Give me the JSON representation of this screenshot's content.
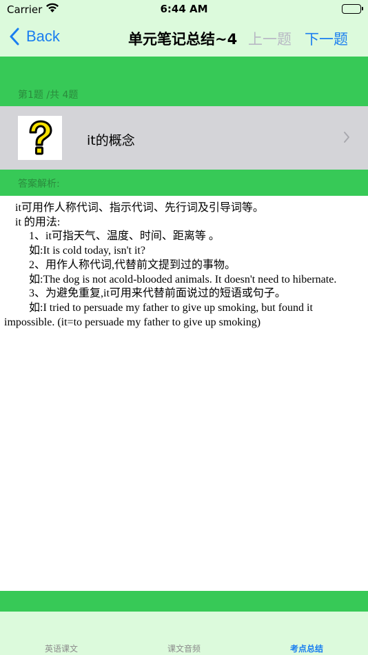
{
  "status_bar": {
    "carrier": "Carrier",
    "time": "6:44 AM",
    "battery_level": 1.0
  },
  "nav": {
    "back_label": "Back",
    "title": "单元笔记总结~4",
    "prev_label": "上一题",
    "next_label": "下一题",
    "accent_color": "#1a7ef0",
    "disabled_color": "#b8b8c4"
  },
  "header": {
    "counter": "第1题 /共 4题"
  },
  "topic": {
    "label": "it的概念",
    "icon": "question-mark-icon"
  },
  "answer": {
    "section_label": "答案解析:",
    "lines": [
      "　it可用作人称代词、指示代词、先行词及引导词等。",
      "　it 的用法:",
      "　　 1、it可指天气、温度、时间、距离等 。",
      "　　 如:It is cold today, isn't it?",
      "　　 2、用作人称代词,代替前文提到过的事物。",
      "　　 如:The dog is not acold-blooded animals. It doesn't need to hibernate.",
      "　　 3、为避免重复,it可用来代替前面说过的短语或句子。",
      "　　 如:I tried to persuade my father to give up smoking, but found it impossible. (it=to persuade my father to give up smoking)"
    ]
  },
  "tabs": [
    {
      "label": "英语课文",
      "active": false
    },
    {
      "label": "课文音频",
      "active": false
    },
    {
      "label": "考点总结",
      "active": true
    }
  ],
  "colors": {
    "green": "#37c957",
    "light_green": "#dcfadc",
    "row_gray": "#d4d4d8"
  }
}
